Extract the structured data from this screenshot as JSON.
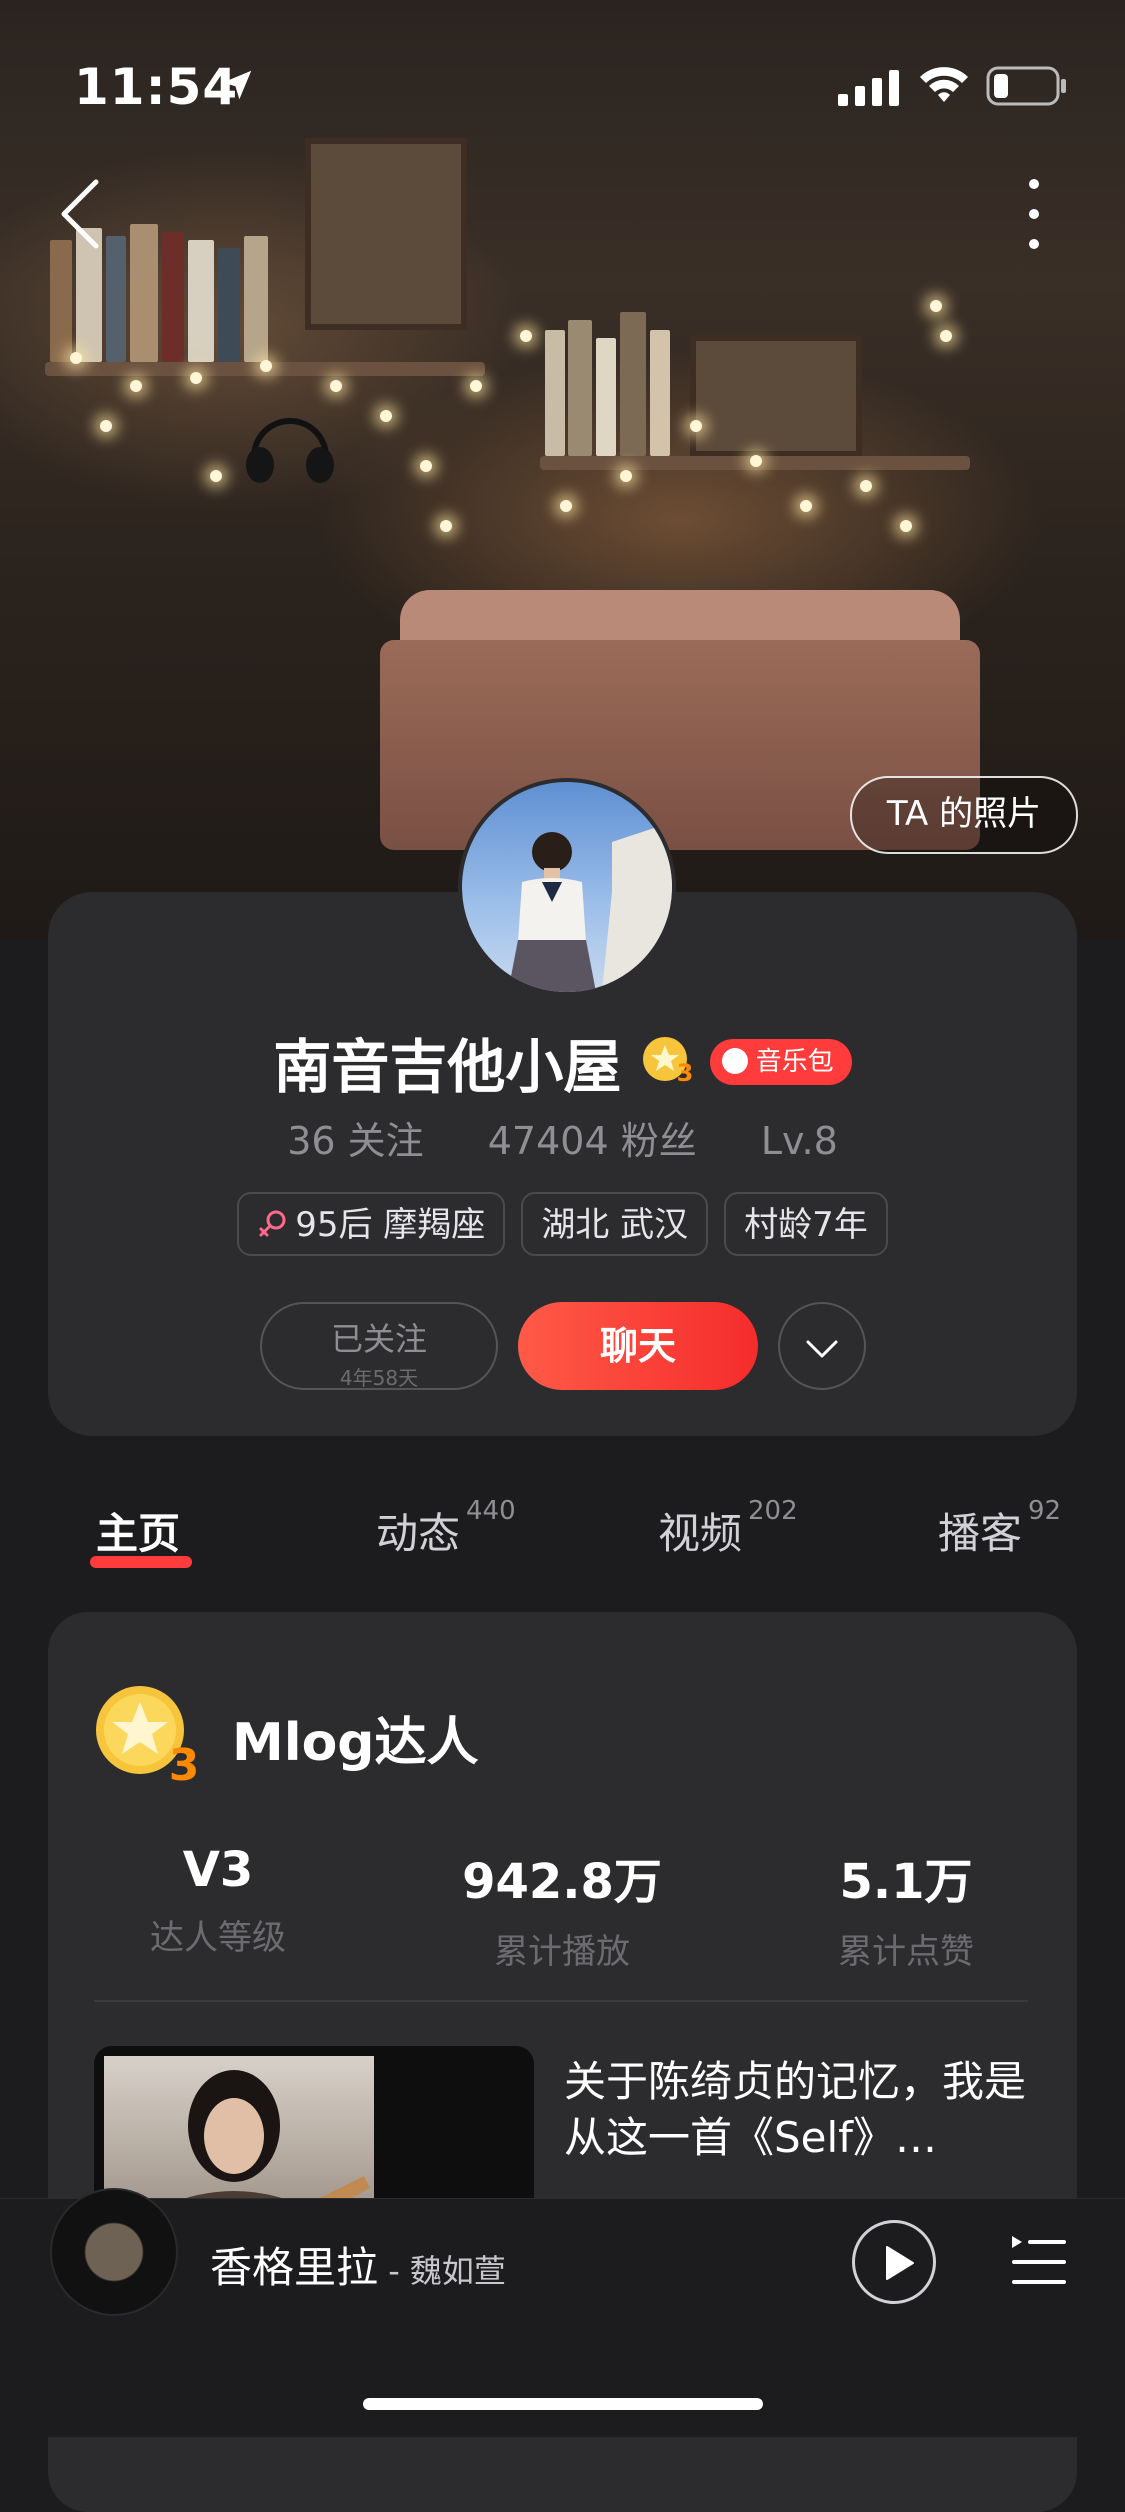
{
  "status_bar": {
    "time": "11:54"
  },
  "header": {
    "photos_button": "TA 的照片"
  },
  "profile": {
    "name": "南音吉他小屋",
    "badge_label": "音乐包",
    "follows": "36 关注",
    "fans": "47404 粉丝",
    "level": "Lv.8",
    "tags": [
      "95后 摩羯座",
      "湖北 武汉",
      "村龄7年"
    ],
    "follow_button": {
      "label": "已关注",
      "sub": "4年58天"
    },
    "chat_button": "聊天"
  },
  "tabs": [
    {
      "label": "主页",
      "count": ""
    },
    {
      "label": "动态",
      "count": "440"
    },
    {
      "label": "视频",
      "count": "202"
    },
    {
      "label": "播客",
      "count": "92"
    }
  ],
  "mlog": {
    "title": "Mlog达人",
    "badge_number": "3",
    "metrics": [
      {
        "value": "V3",
        "label": "达人等级"
      },
      {
        "value": "942.8万",
        "label": "累计播放"
      },
      {
        "value": "5.1万",
        "label": "累计点赞"
      }
    ],
    "video_title": "关于陈绮贞的记忆，我是从这一首《Self》…"
  },
  "player": {
    "song": "香格里拉",
    "separator": " - ",
    "artist": "魏如萱"
  },
  "colors": {
    "accent": "#ff3b3b",
    "card": "#2c2c2e",
    "background": "#1c1c1e"
  }
}
